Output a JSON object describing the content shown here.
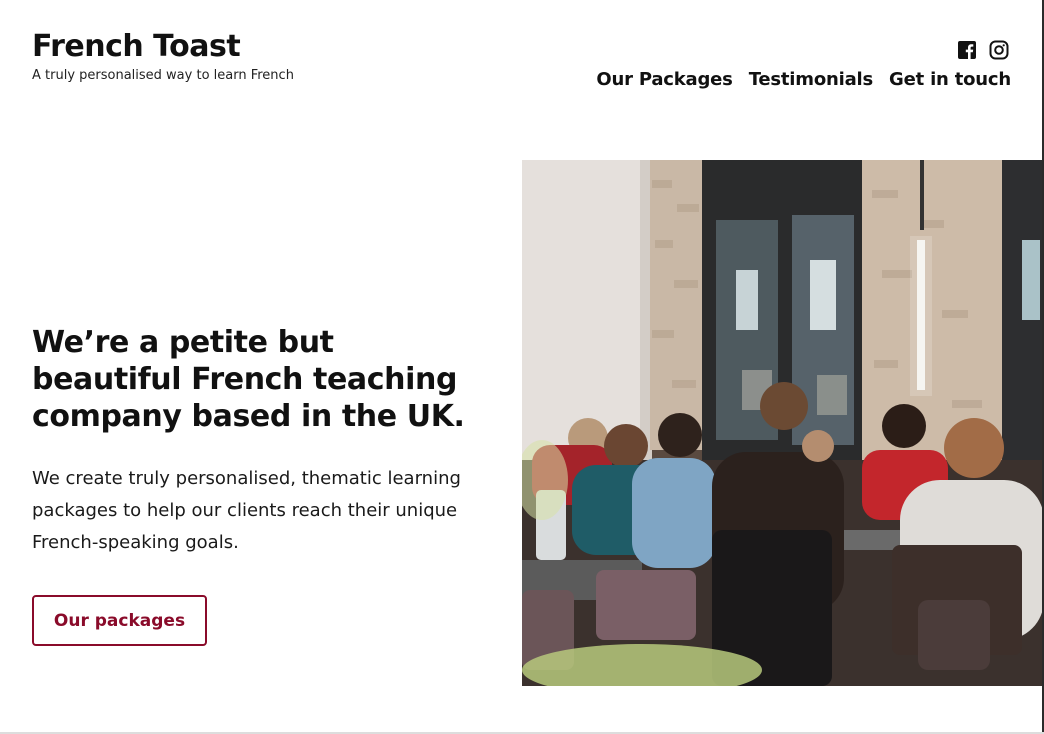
{
  "header": {
    "title": "French Toast",
    "tagline": "A truly personalised way to learn French",
    "social": [
      {
        "name": "facebook-icon"
      },
      {
        "name": "instagram-icon"
      }
    ],
    "nav": [
      {
        "label": "Our Packages"
      },
      {
        "label": "Testimonials"
      },
      {
        "label": "Get in touch"
      }
    ]
  },
  "hero": {
    "heading": "We’re a petite but beautiful French teaching company based in the UK.",
    "body": "We create truly personalised, thematic learning packages to help our clients reach their unique French-speaking goals.",
    "cta_label": "Our packages",
    "image": "restaurant-group-photo"
  },
  "colors": {
    "accent": "#8a0b2a",
    "text": "#111111",
    "background": "#ffffff"
  }
}
